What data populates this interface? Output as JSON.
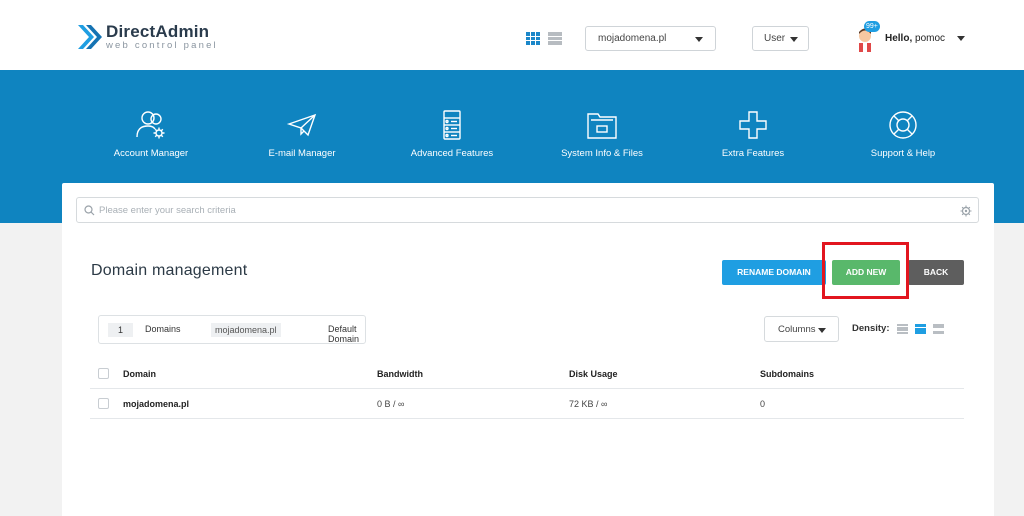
{
  "header": {
    "logo_brand": "DirectAdmin",
    "logo_sub": "web control panel",
    "domain_select": "mojadomena.pl",
    "role_select": "User",
    "notification_count": "99+",
    "greeting": "Hello,",
    "username": "pomoc"
  },
  "nav": {
    "items": [
      {
        "label": "Account Manager",
        "icon": "account-manager-icon"
      },
      {
        "label": "E-mail Manager",
        "icon": "paper-plane-icon"
      },
      {
        "label": "Advanced Features",
        "icon": "server-icon"
      },
      {
        "label": "System Info & Files",
        "icon": "folder-icon"
      },
      {
        "label": "Extra Features",
        "icon": "plus-icon"
      },
      {
        "label": "Support & Help",
        "icon": "lifebuoy-icon"
      }
    ]
  },
  "search": {
    "placeholder": "Please enter your search criteria"
  },
  "page": {
    "title": "Domain management",
    "rename_button": "RENAME DOMAIN",
    "add_button": "ADD NEW",
    "back_button": "BACK"
  },
  "summary": {
    "count": "1",
    "label": "Domains",
    "domain": "mojadomena.pl",
    "default_label": "Default Domain"
  },
  "controls": {
    "columns": "Columns",
    "density": "Density:"
  },
  "table": {
    "headers": [
      "Domain",
      "Bandwidth",
      "Disk Usage",
      "Subdomains"
    ],
    "rows": [
      [
        "mojadomena.pl",
        "0 B / ∞",
        "72 KB / ∞",
        "0"
      ]
    ]
  },
  "colors": {
    "nav_blue": "#0f84c0",
    "rename_blue": "#1f9ee2",
    "add_green": "#59b86b",
    "back_gray": "#5e5e5e",
    "highlight_red": "#e2161f"
  }
}
